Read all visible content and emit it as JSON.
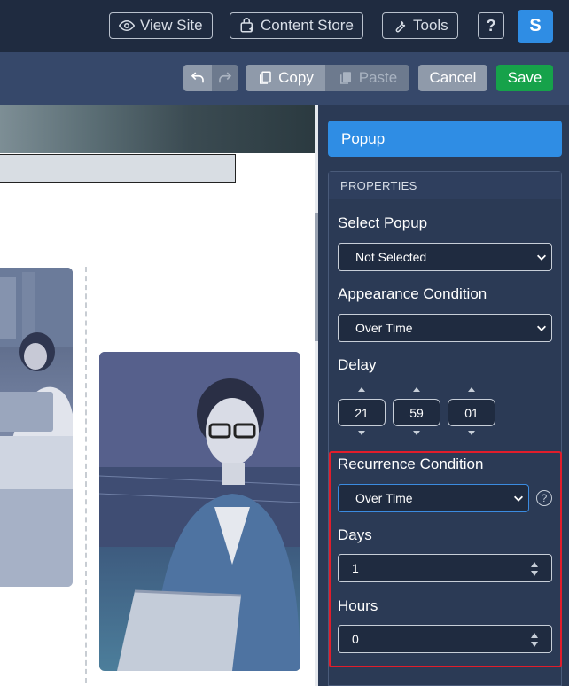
{
  "topnav": {
    "view_site": "View Site",
    "content_store": "Content Store",
    "tools": "Tools",
    "help": "?",
    "avatar_initial": "S"
  },
  "toolbar": {
    "copy": "Copy",
    "paste": "Paste",
    "cancel": "Cancel",
    "save": "Save"
  },
  "panel": {
    "title": "Popup",
    "section": "PROPERTIES",
    "select_popup": {
      "label": "Select Popup",
      "value": "Not Selected"
    },
    "appearance": {
      "label": "Appearance Condition",
      "value": "Over Time"
    },
    "delay": {
      "label": "Delay",
      "h": "21",
      "m": "59",
      "s": "01"
    },
    "recurrence": {
      "label": "Recurrence Condition",
      "value": "Over Time",
      "help": "?"
    },
    "days": {
      "label": "Days",
      "value": "1"
    },
    "hours": {
      "label": "Hours",
      "value": "0"
    }
  },
  "colors": {
    "accent": "#2f8de4",
    "save": "#16a24a",
    "highlight": "#e11d2b",
    "panel_bg": "#2b3a55",
    "nav_bg": "#1f2b40"
  }
}
